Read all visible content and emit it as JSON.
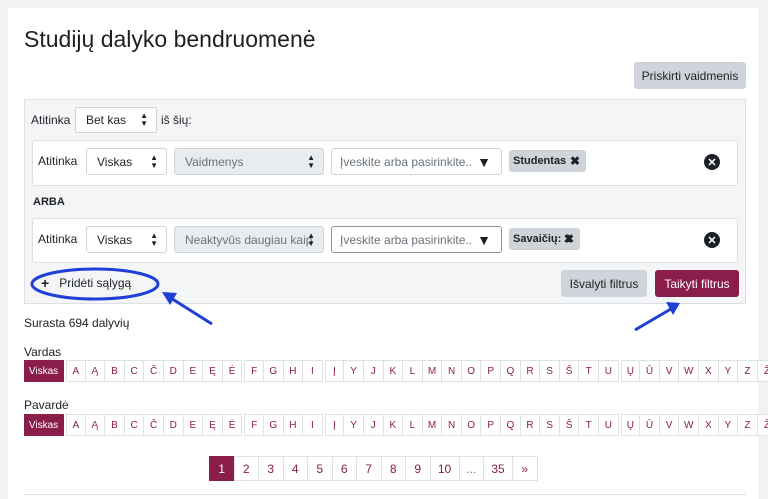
{
  "page": {
    "title": "Studijų dalyko bendruomenė"
  },
  "header": {
    "assign_roles_label": "Priskirti vaidmenis"
  },
  "filter": {
    "match_label": "Atitinka",
    "match_value": "Bet kas",
    "of_these_label": "iš šių:",
    "rows": [
      {
        "match_label": "Atitinka",
        "match_value": "Viskas",
        "field_value": "Vaidmenys",
        "combo_placeholder": "Įveskite arba pasirinkite..",
        "chip_label": "Studentas"
      },
      {
        "match_label": "Atitinka",
        "match_value": "Viskas",
        "field_value": "Neaktyvūs daugiau kaip",
        "combo_placeholder": "Įveskite arba pasirinkite..",
        "chip_label": "Savaičių: 2"
      }
    ],
    "or_label": "ARBA",
    "add_condition_label": "Pridėti sąlygą",
    "clear_label": "Išvalyti filtrus",
    "apply_label": "Taikyti filtrus"
  },
  "results": {
    "count_text": "Surasta 694 dalyvių"
  },
  "firstname": {
    "label": "Vardas",
    "all_label": "Viskas",
    "letters": [
      "A",
      "Ą",
      "B",
      "C",
      "Č",
      "D",
      "E",
      "Ę",
      "Ė",
      "F",
      "G",
      "H",
      "I",
      "Į",
      "Y",
      "J",
      "K",
      "L",
      "M",
      "N",
      "O",
      "P",
      "Q",
      "R",
      "S",
      "Š",
      "T",
      "U",
      "Ų",
      "Ū",
      "V",
      "W",
      "X",
      "Y",
      "Z",
      "Ž"
    ]
  },
  "lastname": {
    "label": "Pavardė",
    "all_label": "Viskas",
    "letters": [
      "A",
      "Ą",
      "B",
      "C",
      "Č",
      "D",
      "E",
      "Ę",
      "Ė",
      "F",
      "G",
      "H",
      "I",
      "Į",
      "Y",
      "J",
      "K",
      "L",
      "M",
      "N",
      "O",
      "P",
      "Q",
      "R",
      "S",
      "Š",
      "T",
      "U",
      "Ų",
      "Ū",
      "V",
      "W",
      "X",
      "Y",
      "Z",
      "Ž"
    ]
  },
  "pagination": {
    "pages": [
      "1",
      "2",
      "3",
      "4",
      "5",
      "6",
      "7",
      "8",
      "9",
      "10"
    ],
    "ellipsis": "...",
    "last": "35",
    "next": "»"
  },
  "colors": {
    "primary": "#8b1d4a",
    "annotation": "#1f3fd6"
  }
}
